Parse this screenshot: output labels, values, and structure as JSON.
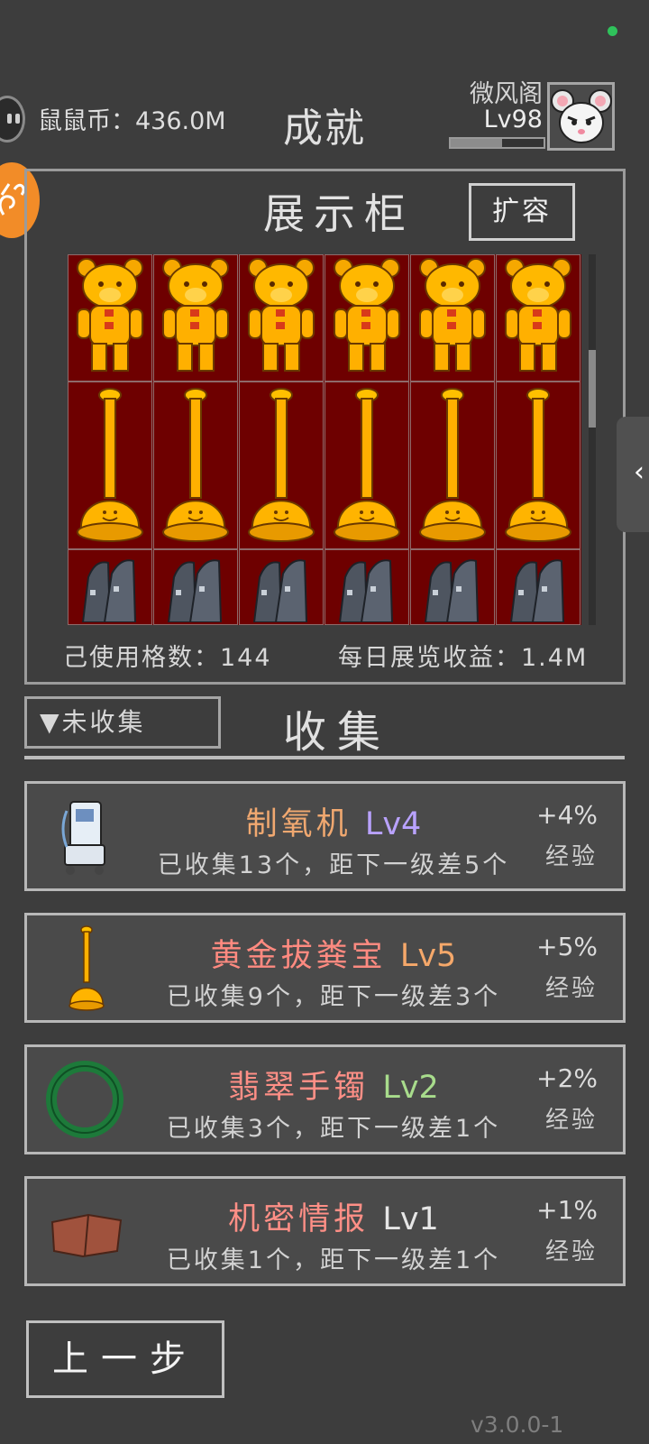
{
  "header": {
    "coin_text": "鼠鼠币：436.0M",
    "title": "成就",
    "player_name": "微风阁",
    "player_level": "Lv98",
    "xp_progress": 0.55
  },
  "cabinet": {
    "title": "展示柜",
    "expand_label": "扩容",
    "used_cells_text": "己使用格数：144",
    "daily_income_text": "每日展览收益：1.4M",
    "rows": [
      {
        "item": "golden-bear-statue",
        "count": 6
      },
      {
        "item": "golden-plunger",
        "count": 6
      },
      {
        "item": "metal-boots",
        "count": 6
      }
    ]
  },
  "collect": {
    "filter_label": "▼未收集",
    "title": "收集"
  },
  "collections": [
    {
      "icon": "oxygen-machine-icon",
      "name": "制氧机",
      "name_color": "#f0a870",
      "level": "Lv4",
      "level_color": "#b9a2ff",
      "desc": "已收集13个，距下一级差5个",
      "bonus": "+4%",
      "exp": "经验"
    },
    {
      "icon": "golden-plunger-icon",
      "name": "黄金拔粪宝",
      "name_color": "#ff8a80",
      "level": "Lv5",
      "level_color": "#f5a86a",
      "desc": "已收集9个，距下一级差3个",
      "bonus": "+5%",
      "exp": "经验"
    },
    {
      "icon": "jade-bracelet-icon",
      "name": "翡翠手镯",
      "name_color": "#ff8f86",
      "level": "Lv2",
      "level_color": "#a8dc8c",
      "desc": "已收集3个，距下一级差1个",
      "bonus": "+2%",
      "exp": "经验"
    },
    {
      "icon": "secret-report-icon",
      "name": "机密情报",
      "name_color": "#ff8f86",
      "level": "Lv1",
      "level_color": "#e6e6e6",
      "desc": "已收集1个，距下一级差1个",
      "bonus": "+1%",
      "exp": "经验"
    }
  ],
  "footer": {
    "prev_label": "上一步",
    "version": "v3.0.0-1"
  }
}
